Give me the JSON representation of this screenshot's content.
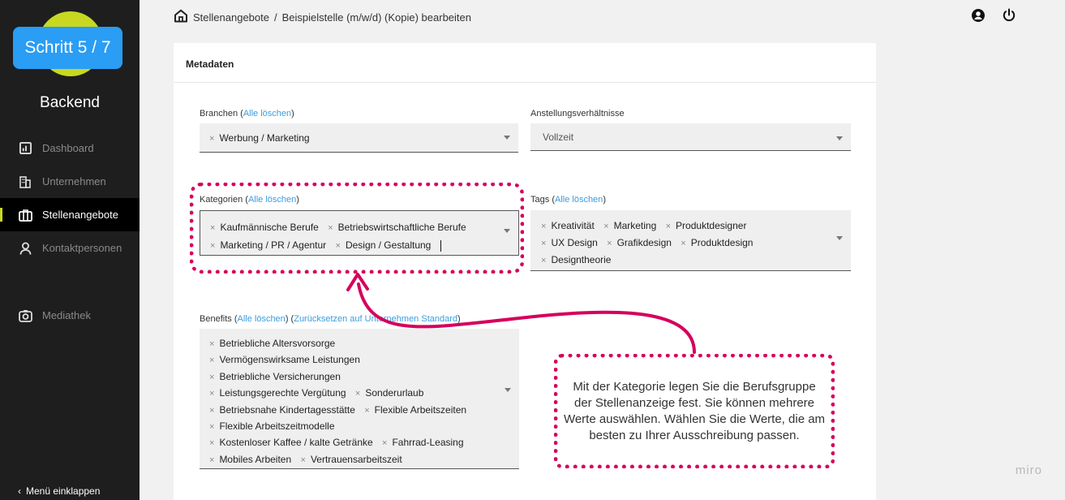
{
  "sidebar": {
    "step_label": "Schritt 5 / 7",
    "title": "Backend",
    "items": [
      {
        "label": "Dashboard",
        "icon": "dashboard-icon"
      },
      {
        "label": "Unternehmen",
        "icon": "building-icon"
      },
      {
        "label": "Stellenangebote",
        "icon": "briefcase-icon"
      },
      {
        "label": "Kontaktpersonen",
        "icon": "person-icon"
      },
      {
        "label": "Mediathek",
        "icon": "camera-icon"
      }
    ],
    "collapse_label": "Menü einklappen",
    "accent_color": "#c8d820",
    "step_color": "#2a9df4"
  },
  "breadcrumb": {
    "home_icon": "home-icon",
    "root": "Stellenangebote",
    "separator": "/",
    "current": "Beispielstelle (m/w/d) (Kopie) bearbeiten"
  },
  "header_icons": [
    "user-icon",
    "power-icon"
  ],
  "card": {
    "title": "Metadaten",
    "branchen": {
      "label": "Branchen",
      "clear_label": "Alle löschen",
      "chips": [
        "Werbung / Marketing"
      ]
    },
    "anstellung": {
      "label": "Anstellungsverhältnisse",
      "value": "Vollzeit"
    },
    "kategorien": {
      "label": "Kategorien",
      "clear_label": "Alle löschen",
      "chips": [
        "Kaufmännische Berufe",
        "Betriebswirtschaftliche Berufe",
        "Marketing / PR / Agentur",
        "Design / Gestaltung"
      ]
    },
    "tags": {
      "label": "Tags",
      "clear_label": "Alle löschen",
      "chips": [
        "Kreativität",
        "Marketing",
        "Produktdesigner",
        "UX Design",
        "Grafikdesign",
        "Produktdesign",
        "Designtheorie"
      ]
    },
    "benefits": {
      "label": "Benefits",
      "clear_label": "Alle löschen",
      "reset_label": "Zurücksetzen auf Unternehmen Standard",
      "chips": [
        "Betriebliche Altersvorsorge",
        "Vermögenswirksame Leistungen",
        "Betriebliche Versicherungen",
        "Leistungsgerechte Vergütung",
        "Sonderurlaub",
        "Betriebsnahe Kindertagesstätte",
        "Flexible Arbeitszeiten",
        "Flexible Arbeitszeitmodelle",
        "Kostenloser Kaffee / kalte Getränke",
        "Fahrrad-Leasing",
        "Mobiles Arbeiten",
        "Vertrauensarbeitszeit"
      ]
    }
  },
  "callout": {
    "text": "Mit der Kategorie legen Sie die Berufsgruppe der Stellenanzeige fest. Sie können mehrere Werte auswählen. Wählen Sie die Werte, die am besten zu Ihrer Ausschreibung passen.",
    "color": "#d6005c"
  },
  "watermark": "miro"
}
